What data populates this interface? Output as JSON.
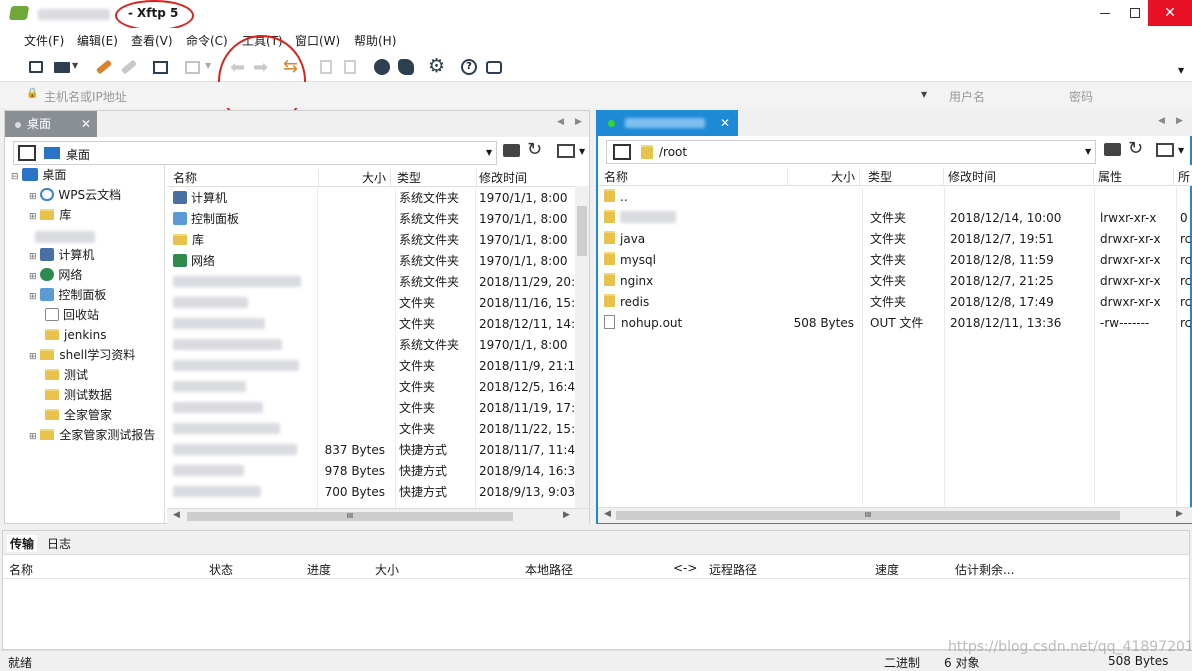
{
  "window": {
    "title": "Xftp 5",
    "title_prefix": "-"
  },
  "menu": [
    "文件(F)",
    "编辑(E)",
    "查看(V)",
    "命令(C)",
    "工具(T)",
    "窗口(W)",
    "帮助(H)"
  ],
  "address": {
    "host_placeholder": "主机名或IP地址",
    "user_placeholder": "用户名",
    "pass_placeholder": "密码"
  },
  "left": {
    "tab_label": "桌面",
    "path": "桌面",
    "tree": [
      {
        "label": "桌面",
        "level": 0
      },
      {
        "label": "WPS云文档",
        "level": 1
      },
      {
        "label": "库",
        "level": 1
      },
      {
        "label": "",
        "level": 1
      },
      {
        "label": "计算机",
        "level": 1
      },
      {
        "label": "网络",
        "level": 1
      },
      {
        "label": "控制面板",
        "level": 1
      },
      {
        "label": "回收站",
        "level": 1
      },
      {
        "label": "jenkins",
        "level": 1
      },
      {
        "label": "shell学习资料",
        "level": 1
      },
      {
        "label": "测试",
        "level": 1
      },
      {
        "label": "测试数据",
        "level": 1
      },
      {
        "label": "全家管家",
        "level": 1
      },
      {
        "label": "全家管家测试报告",
        "level": 1
      }
    ],
    "columns": [
      "名称",
      "大小",
      "类型",
      "修改时间"
    ],
    "rows": [
      {
        "name": "计算机",
        "size": "",
        "type": "系统文件夹",
        "time": "1970/1/1, 8:00"
      },
      {
        "name": "控制面板",
        "size": "",
        "type": "系统文件夹",
        "time": "1970/1/1, 8:00"
      },
      {
        "name": "库",
        "size": "",
        "type": "系统文件夹",
        "time": "1970/1/1, 8:00"
      },
      {
        "name": "网络",
        "size": "",
        "type": "系统文件夹",
        "time": "1970/1/1, 8:00"
      },
      {
        "name": "",
        "size": "",
        "type": "系统文件夹",
        "time": "2018/11/29, 20:4"
      },
      {
        "name": "",
        "size": "",
        "type": "文件夹",
        "time": "2018/11/16, 15:4"
      },
      {
        "name": "",
        "size": "",
        "type": "文件夹",
        "time": "2018/12/11, 14:3"
      },
      {
        "name": "",
        "size": "",
        "type": "系统文件夹",
        "time": "1970/1/1, 8:00"
      },
      {
        "name": "",
        "size": "",
        "type": "文件夹",
        "time": "2018/11/9, 21:11"
      },
      {
        "name": "",
        "size": "",
        "type": "文件夹",
        "time": "2018/12/5, 16:46"
      },
      {
        "name": "",
        "size": "",
        "type": "文件夹",
        "time": "2018/11/19, 17:2"
      },
      {
        "name": "",
        "size": "",
        "type": "文件夹",
        "time": "2018/11/22, 15:1"
      },
      {
        "name": "",
        "size": "837 Bytes",
        "type": "快捷方式",
        "time": "2018/11/7, 11:49"
      },
      {
        "name": "",
        "size": "978 Bytes",
        "type": "快捷方式",
        "time": "2018/9/14, 16:37"
      },
      {
        "name": "",
        "size": "700 Bytes",
        "type": "快捷方式",
        "time": "2018/9/13, 9:03"
      }
    ],
    "scroll_thumb": "III"
  },
  "right": {
    "tab_label": "",
    "path": "/root",
    "columns": [
      "名称",
      "大小",
      "类型",
      "修改时间",
      "属性",
      "所"
    ],
    "rows": [
      {
        "name": "..",
        "size": "",
        "type": "",
        "time": "",
        "attr": "",
        "owner": "",
        "kind": "folder"
      },
      {
        "name": "",
        "size": "",
        "type": "文件夹",
        "time": "2018/12/14, 10:00",
        "attr": "lrwxr-xr-x",
        "owner": "0",
        "kind": "blur"
      },
      {
        "name": "java",
        "size": "",
        "type": "文件夹",
        "time": "2018/12/7, 19:51",
        "attr": "drwxr-xr-x",
        "owner": "rc",
        "kind": "folder"
      },
      {
        "name": "mysql",
        "size": "",
        "type": "文件夹",
        "time": "2018/12/8, 11:59",
        "attr": "drwxr-xr-x",
        "owner": "rc",
        "kind": "folder"
      },
      {
        "name": "nginx",
        "size": "",
        "type": "文件夹",
        "time": "2018/12/7, 21:25",
        "attr": "drwxr-xr-x",
        "owner": "rc",
        "kind": "folder"
      },
      {
        "name": "redis",
        "size": "",
        "type": "文件夹",
        "time": "2018/12/8, 17:49",
        "attr": "drwxr-xr-x",
        "owner": "rc",
        "kind": "folder"
      },
      {
        "name": "nohup.out",
        "size": "508 Bytes",
        "type": "OUT 文件",
        "time": "2018/12/11, 13:36",
        "attr": "-rw-------",
        "owner": "rc",
        "kind": "file"
      }
    ],
    "scroll_thumb": "III"
  },
  "transfer": {
    "tabs": [
      "传输",
      "日志"
    ],
    "columns": [
      "名称",
      "状态",
      "进度",
      "大小",
      "本地路径",
      "<->",
      "远程路径",
      "速度",
      "估计剩余..."
    ]
  },
  "status": {
    "left": "就绪",
    "mode": "二进制",
    "count": "6 对象",
    "size": "508 Bytes",
    "watermark": "https://blog.csdn.net/qq_41897201"
  },
  "colors": {
    "accent": "#1e8ad6",
    "active_tab": "#1e8ad6",
    "inactive_tab": "#8a8f96",
    "annotation": "#e0201b"
  }
}
